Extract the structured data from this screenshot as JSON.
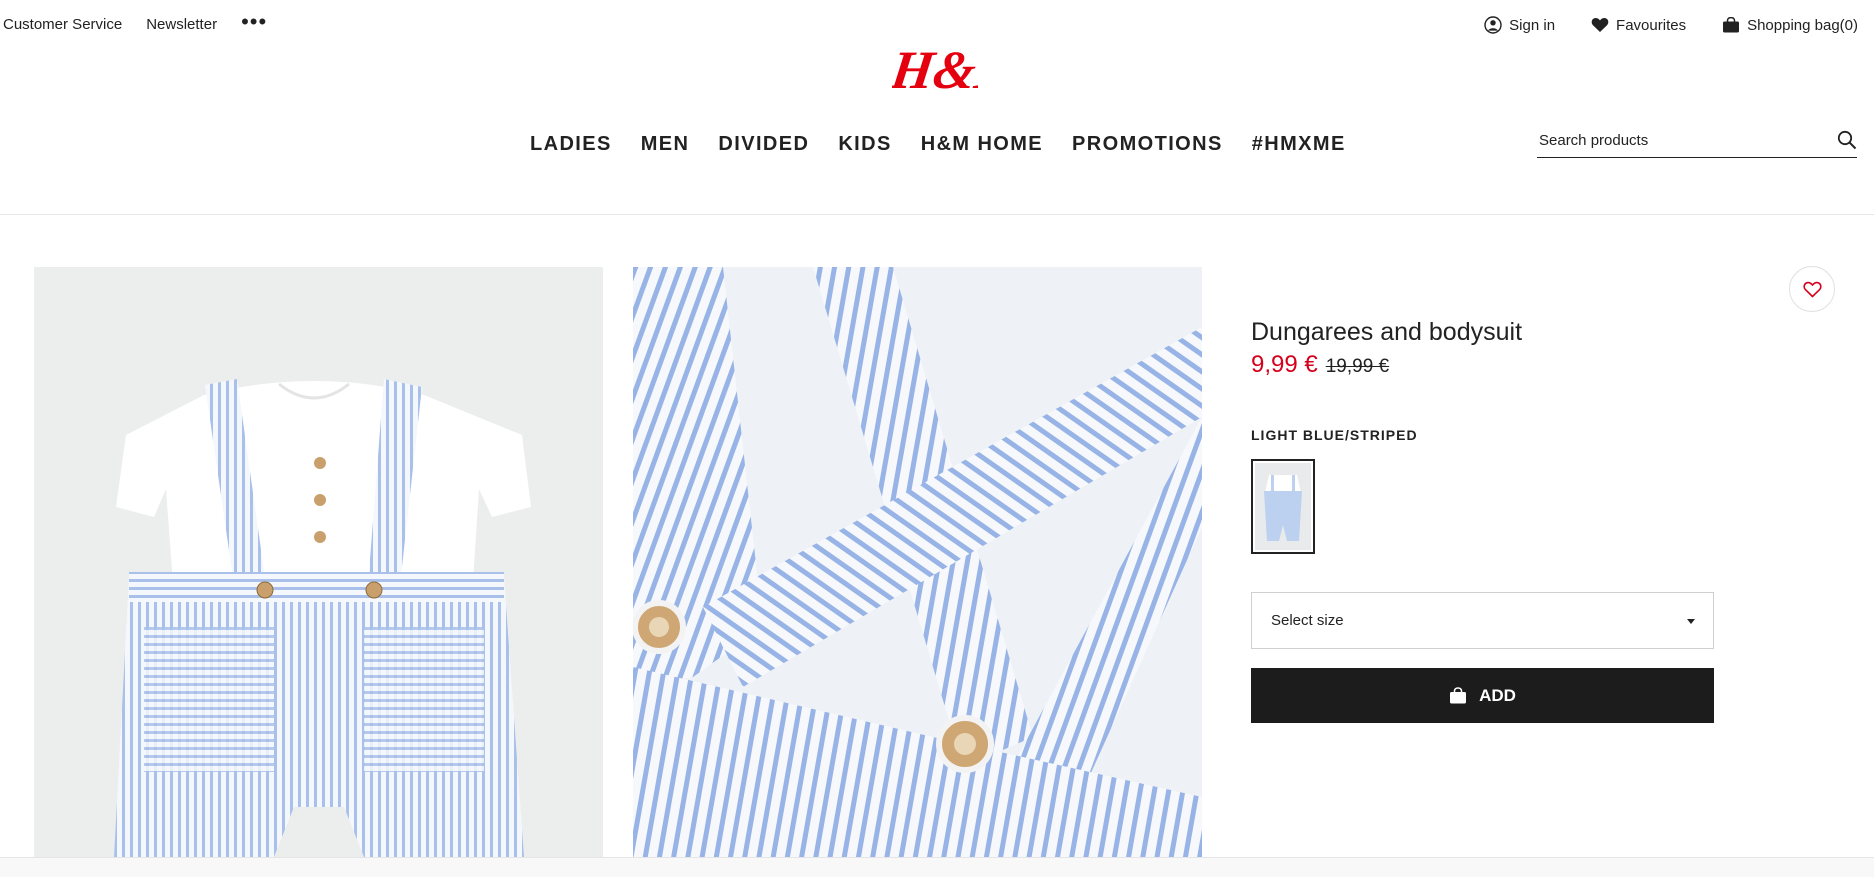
{
  "top_links": {
    "customer_service": "Customer Service",
    "newsletter": "Newsletter",
    "more": "•••"
  },
  "account": {
    "sign_in": "Sign in",
    "favourites": "Favourites",
    "shopping_bag": "Shopping bag(0)"
  },
  "brand": {
    "logo_text": "H&M",
    "color": "#e50010"
  },
  "nav": {
    "items": [
      "LADIES",
      "MEN",
      "DIVIDED",
      "KIDS",
      "H&M HOME",
      "PROMOTIONS",
      "#HMXME"
    ]
  },
  "search": {
    "placeholder": "Search products"
  },
  "product": {
    "title": "Dungarees and bodysuit",
    "price_sale": "9,99 €",
    "price_original": "19,99 €",
    "color_name": "LIGHT BLUE/STRIPED",
    "size_select_label": "Select size",
    "add_button_label": "ADD",
    "sale_color": "#d6001c"
  },
  "icons": {
    "user": "user-icon",
    "heart": "heart-icon",
    "bag": "bag-icon",
    "search": "search-icon",
    "chevron": "chevron-down-icon"
  }
}
